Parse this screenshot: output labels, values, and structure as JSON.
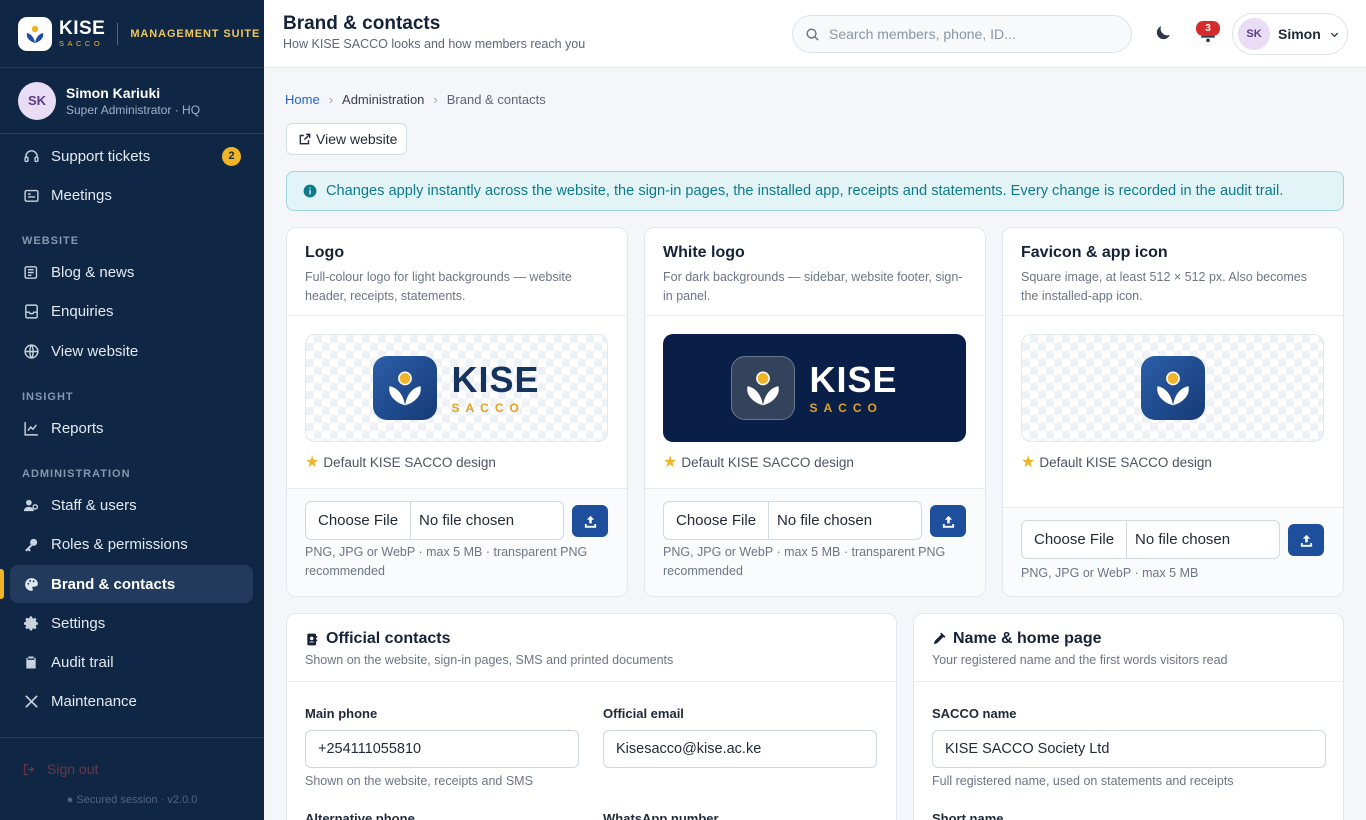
{
  "brand": {
    "name": "KISE",
    "sub": "SACCO",
    "suite": "MANAGEMENT SUITE"
  },
  "user": {
    "initials": "SK",
    "name": "Simon Kariuki",
    "role": "Super Administrator · HQ",
    "short_name": "Simon"
  },
  "nav": {
    "support": {
      "label": "Support tickets",
      "badge": "2"
    },
    "meetings": {
      "label": "Meetings"
    },
    "section_website": "WEBSITE",
    "blog": {
      "label": "Blog & news"
    },
    "enquiries": {
      "label": "Enquiries"
    },
    "view_website": {
      "label": "View website"
    },
    "section_insight": "INSIGHT",
    "reports": {
      "label": "Reports"
    },
    "section_admin": "ADMINISTRATION",
    "staff": {
      "label": "Staff & users"
    },
    "roles": {
      "label": "Roles & permissions"
    },
    "brand_contacts": {
      "label": "Brand & contacts"
    },
    "settings": {
      "label": "Settings"
    },
    "audit": {
      "label": "Audit trail"
    },
    "maintenance": {
      "label": "Maintenance"
    },
    "signout": "Sign out",
    "secured": "Secured session · v2.0.0"
  },
  "header": {
    "title": "Brand & contacts",
    "subtitle": "How KISE SACCO looks and how members reach you",
    "search_placeholder": "Search members, phone, ID...",
    "notif_count": "3"
  },
  "breadcrumb": {
    "home": "Home",
    "admin": "Administration",
    "current": "Brand & contacts"
  },
  "view_website_btn": "View website",
  "alert": "Changes apply instantly across the website, the sign-in pages, the installed app, receipts and statements. Every change is recorded in the audit trail.",
  "logos": {
    "logo": {
      "title": "Logo",
      "desc": "Full-colour logo for light backgrounds — website header, receipts, statements.",
      "default": "Default KISE SACCO design",
      "choose": "Choose File",
      "nofile": "No file chosen",
      "hint": "PNG, JPG or WebP · max 5 MB · transparent PNG recommended"
    },
    "white": {
      "title": "White logo",
      "desc": "For dark backgrounds — sidebar, website footer, sign-in panel.",
      "default": "Default KISE SACCO design",
      "choose": "Choose File",
      "nofile": "No file chosen",
      "hint": "PNG, JPG or WebP · max 5 MB · transparent PNG recommended"
    },
    "favicon": {
      "title": "Favicon & app icon",
      "desc": "Square image, at least 512 × 512 px. Also becomes the installed-app icon.",
      "default": "Default KISE SACCO design",
      "choose": "Choose File",
      "nofile": "No file chosen",
      "hint": "PNG, JPG or WebP · max 5 MB"
    }
  },
  "contacts": {
    "title": "Official contacts",
    "subtitle": "Shown on the website, sign-in pages, SMS and printed documents",
    "main_phone_label": "Main phone",
    "main_phone": "+254111055810",
    "main_phone_hint": "Shown on the website, receipts and SMS",
    "email_label": "Official email",
    "email": "Kisesacco@kise.ac.ke",
    "alt_phone_label": "Alternative phone",
    "whatsapp_label": "WhatsApp number"
  },
  "name_home": {
    "title": "Name & home page",
    "subtitle": "Your registered name and the first words visitors read",
    "sacco_name_label": "SACCO name",
    "sacco_name": "KISE SACCO Society Ltd",
    "sacco_name_hint": "Full registered name, used on statements and receipts",
    "short_name_label": "Short name"
  },
  "colors": {
    "sidebar": "#0f2744",
    "accent": "#f0b429",
    "primary": "#1d4f9c",
    "info": "#0d7b8d",
    "danger": "#d62b2b"
  },
  "icons": [
    "headset-icon",
    "calendar-icon",
    "newspaper-icon",
    "inbox-icon",
    "globe-icon",
    "chart-icon",
    "users-icon",
    "key-icon",
    "palette-icon",
    "gear-icon",
    "clipboard-icon",
    "tools-icon",
    "logout-icon",
    "shield-icon",
    "search-icon",
    "moon-icon",
    "bell-icon",
    "chevron-down-icon",
    "external-link-icon",
    "info-icon",
    "star-icon",
    "upload-icon",
    "contact-book-icon",
    "pen-icon"
  ]
}
